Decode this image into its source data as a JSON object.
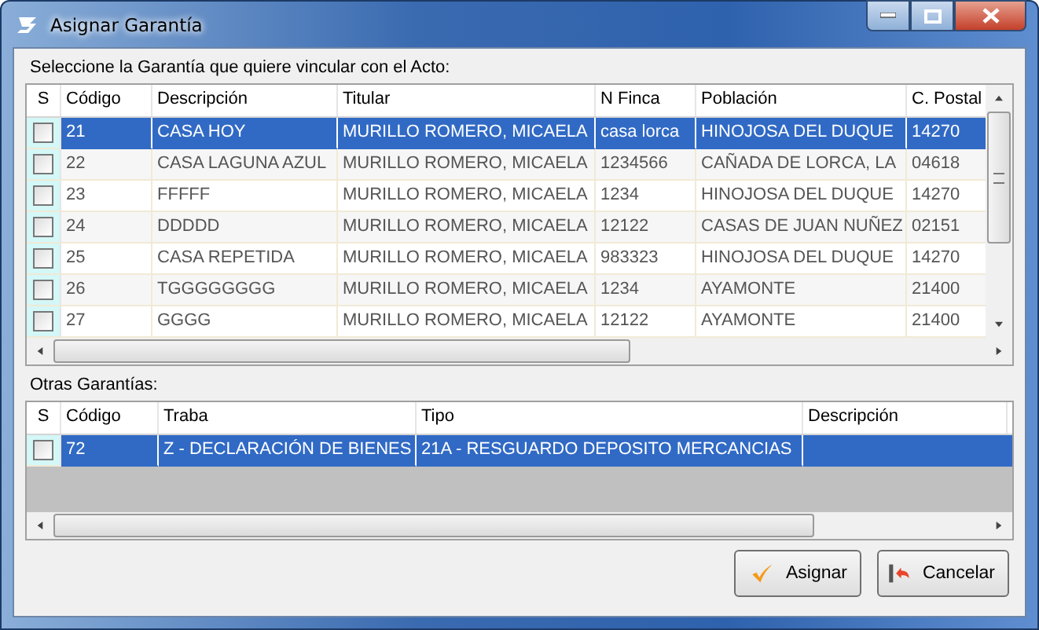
{
  "window": {
    "title": "Asignar Garantía"
  },
  "main_grid": {
    "label": "Seleccione la Garantía que quiere vincular con el Acto:",
    "select_header": "S",
    "columns": [
      "Código",
      "Descripción",
      "Titular",
      "N Finca",
      "Población",
      "C. Postal"
    ],
    "rows": [
      {
        "selected": true,
        "checked": false,
        "cells": [
          "21",
          "CASA HOY",
          "MURILLO ROMERO, MICAELA",
          "casa lorca",
          "HINOJOSA DEL DUQUE",
          "14270"
        ]
      },
      {
        "selected": false,
        "checked": false,
        "cells": [
          "22",
          "CASA LAGUNA AZUL",
          "MURILLO ROMERO, MICAELA",
          "1234566",
          "CAÑADA DE LORCA, LA",
          "04618"
        ]
      },
      {
        "selected": false,
        "checked": false,
        "cells": [
          "23",
          "FFFFF",
          "MURILLO ROMERO, MICAELA",
          "1234",
          "HINOJOSA DEL DUQUE",
          "14270"
        ]
      },
      {
        "selected": false,
        "checked": false,
        "cells": [
          "24",
          "DDDDD",
          "MURILLO ROMERO, MICAELA",
          "12122",
          "CASAS DE JUAN NUÑEZ",
          "02151"
        ]
      },
      {
        "selected": false,
        "checked": false,
        "cells": [
          "25",
          "CASA REPETIDA",
          "MURILLO ROMERO, MICAELA",
          "983323",
          "HINOJOSA DEL DUQUE",
          "14270"
        ]
      },
      {
        "selected": false,
        "checked": false,
        "cells": [
          "26",
          "TGGGGGGGG",
          "MURILLO ROMERO, MICAELA",
          "1234",
          "AYAMONTE",
          "21400"
        ]
      },
      {
        "selected": false,
        "checked": false,
        "cells": [
          "27",
          "GGGG",
          "MURILLO ROMERO, MICAELA",
          "12122",
          "AYAMONTE",
          "21400"
        ]
      }
    ]
  },
  "other_grid": {
    "label": "Otras Garantías:",
    "select_header": "S",
    "columns": [
      "Código",
      "Traba",
      "Tipo",
      "Descripción"
    ],
    "rows": [
      {
        "selected": true,
        "checked": false,
        "cells": [
          "72",
          "Z - DECLARACIÓN DE BIENES",
          "21A - RESGUARDO DEPOSITO MERCANCIAS"
        ]
      }
    ]
  },
  "buttons": [
    {
      "kind": "assign",
      "label": "Asignar"
    },
    {
      "kind": "cancel",
      "label": "Cancelar"
    }
  ]
}
